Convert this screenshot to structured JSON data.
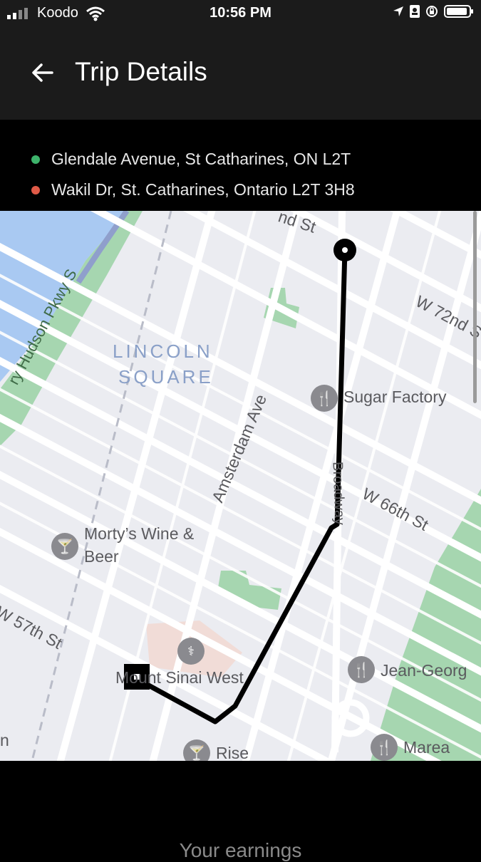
{
  "status_bar": {
    "carrier": "Koodo",
    "time": "10:56 PM"
  },
  "header": {
    "title": "Trip Details"
  },
  "trip": {
    "pickup": "Glendale Avenue, St Catharines, ON L2T",
    "dropoff": "Wakil Dr, St. Catharines, Ontario L2T 3H8",
    "pickup_color": "#3db36b",
    "dropoff_color": "#e05a47"
  },
  "map": {
    "labels": {
      "street_top": "nd St",
      "w72": "W 72nd S",
      "hudson": "ry Hudson Pkwy S",
      "neighborhood_line1": "LINCOLN",
      "neighborhood_line2": "SQUARE",
      "amsterdam": "Amsterdam Ave",
      "broadway": "Broadway",
      "w66": "W 66th St",
      "w57": "W 57th St",
      "left_edge": "n"
    },
    "pois": {
      "sugar_factory": "Sugar Factory",
      "mortys_line1": "Morty’s Wine &",
      "mortys_line2": "Beer",
      "mount_sinai": "Mount Sinai West",
      "jean_georges": "Jean-Georg",
      "rise": "Rise",
      "marea": "Marea"
    }
  },
  "footer": {
    "earnings_label": "Your earnings"
  }
}
